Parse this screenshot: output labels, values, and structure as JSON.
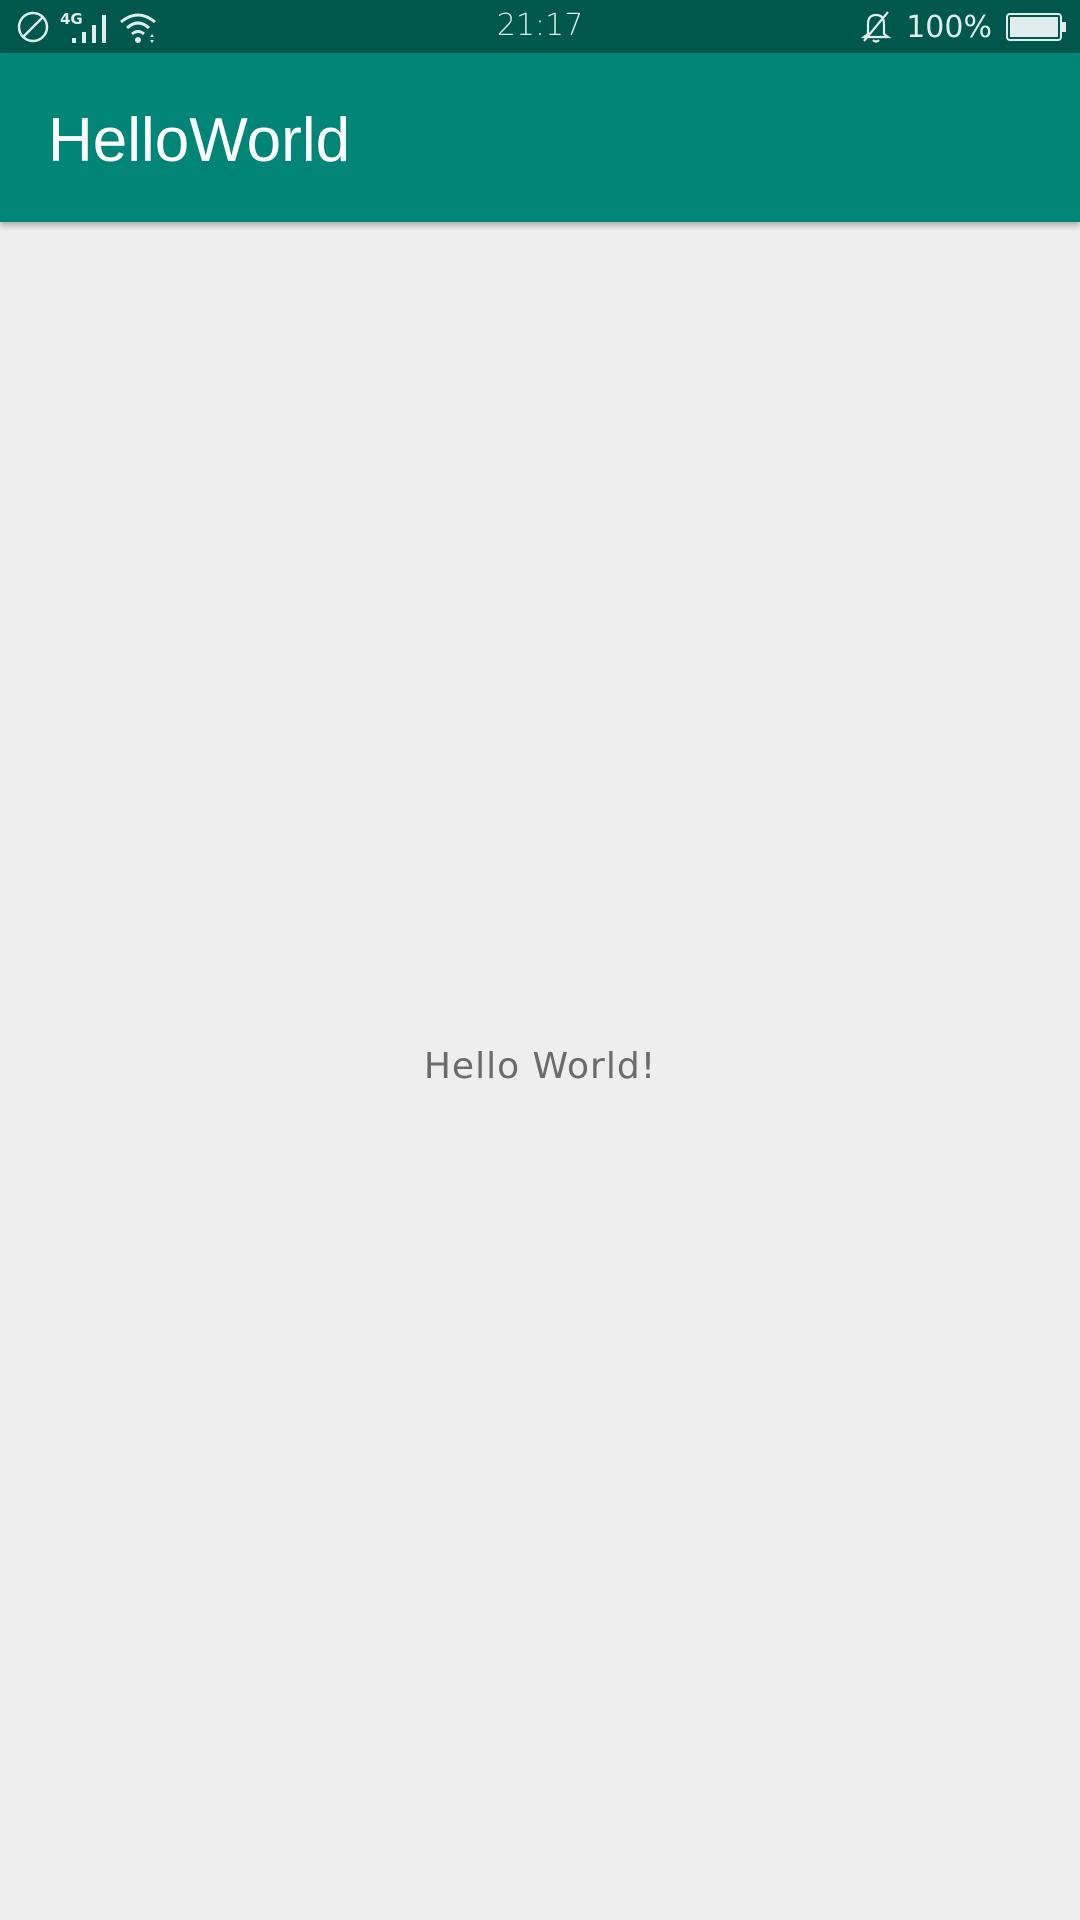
{
  "status_bar": {
    "network_type": "4G",
    "time": "21:17",
    "battery_percent": "100%",
    "battery_level": 1.0,
    "icons": [
      "do-not-disturb-icon",
      "cellular-signal-icon",
      "wifi-icon",
      "notifications-off-icon",
      "battery-icon"
    ],
    "colors": {
      "background": "#00574b",
      "foreground": "#dfeeec"
    }
  },
  "app_bar": {
    "title": "HelloWorld",
    "color": "#008577"
  },
  "main": {
    "text": "Hello World!",
    "background": "#eeeeef"
  }
}
